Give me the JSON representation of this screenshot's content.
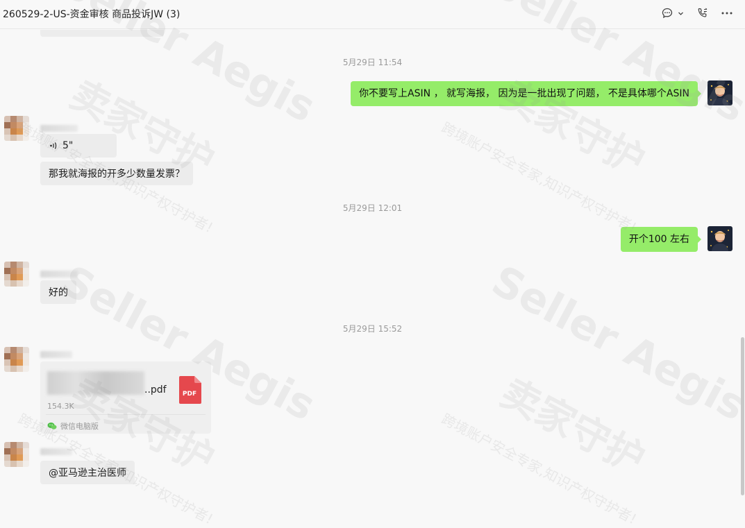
{
  "header": {
    "title": "260529-2-US-资金审核 商品投诉JW (3)",
    "icons": [
      "chat-icon",
      "chevron-down-icon",
      "call-icon",
      "more-icon"
    ]
  },
  "watermarks": {
    "brand": "Seller Aegis",
    "cn_main": "卖家守护",
    "cn_sub": "跨境账户安全专家,知识产权守护者!"
  },
  "messages": {
    "ts1": "5月29日 11:54",
    "out1": "你不要写上ASIN ， 就写海报， 因为是一批出现了问题， 不是具体哪个ASIN",
    "voice_duration": "5\"",
    "in1": "那我就海报的开多少数量发票？",
    "ts2": "5月29日 12:01",
    "out2": "开个100 左右",
    "in2": "好的",
    "ts3": "5月29日 15:52",
    "file": {
      "name_suffix": "..pdf",
      "size": "154.3K",
      "source": "微信电脑版",
      "badge": "PDF"
    },
    "in3": "@亚马逊主治医师"
  },
  "colors": {
    "outgoing_bubble": "#95ec69",
    "incoming_bubble": "#ececec",
    "background": "#f8f8f8",
    "pdf_badge": "#e5484d"
  }
}
